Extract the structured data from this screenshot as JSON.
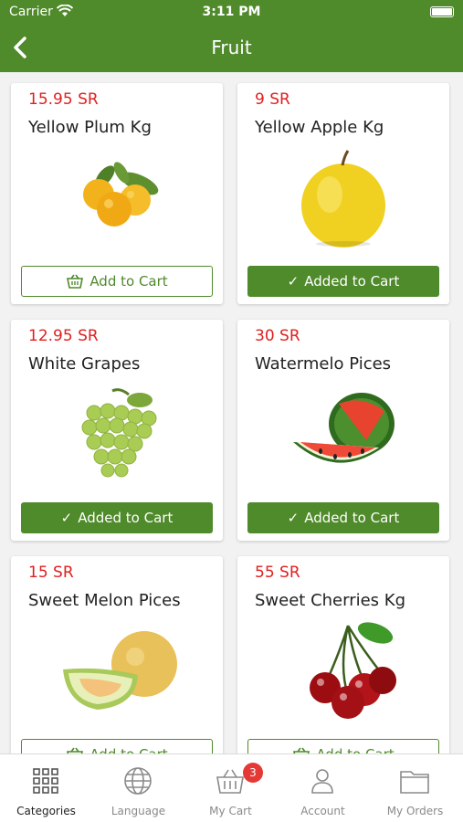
{
  "status": {
    "carrier": "Carrier",
    "time": "3:11 PM"
  },
  "nav": {
    "title": "Fruit"
  },
  "buttons": {
    "add": "Add to Cart",
    "added": "Added to Cart"
  },
  "products": [
    {
      "price": "15.95 SR",
      "name": "Yellow Plum Kg",
      "state": "add"
    },
    {
      "price": "9 SR",
      "name": "Yellow Apple Kg",
      "state": "added"
    },
    {
      "price": "12.95 SR",
      "name": "White Grapes",
      "state": "added"
    },
    {
      "price": "30 SR",
      "name": "Watermelo Pices",
      "state": "added"
    },
    {
      "price": "15 SR",
      "name": "Sweet Melon Pices",
      "state": "add"
    },
    {
      "price": "55 SR",
      "name": "Sweet Cherries Kg",
      "state": "add"
    }
  ],
  "tabs": [
    {
      "label": "Categories",
      "icon": "grid-icon",
      "active": true
    },
    {
      "label": "Language",
      "icon": "globe-icon",
      "active": false
    },
    {
      "label": "My Cart",
      "icon": "basket-icon",
      "active": false,
      "badge": "3"
    },
    {
      "label": "Account",
      "icon": "user-icon",
      "active": false
    },
    {
      "label": "My Orders",
      "icon": "folder-icon",
      "active": false
    }
  ],
  "colors": {
    "brand": "#4f8a2b",
    "price": "#e02020",
    "badge": "#e53935"
  }
}
